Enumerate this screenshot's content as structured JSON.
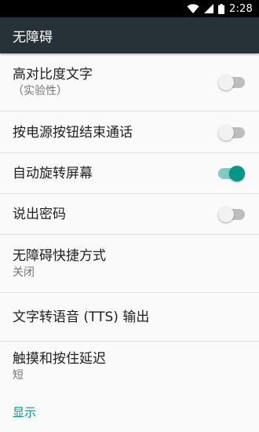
{
  "status_bar": {
    "time": "2:28",
    "icons": [
      "wifi-icon",
      "signal-icon",
      "battery-icon"
    ]
  },
  "app_bar": {
    "title": "无障碍"
  },
  "settings": {
    "items": [
      {
        "title": "高对比度文字",
        "summary": "（实验性）",
        "toggle": "off"
      },
      {
        "title": "按电源按钮结束通话",
        "toggle": "off"
      },
      {
        "title": "自动旋转屏幕",
        "toggle": "on"
      },
      {
        "title": "说出密码",
        "toggle": "off"
      },
      {
        "title": "无障碍快捷方式",
        "summary": "关闭"
      },
      {
        "title": "文字转语音 (TTS) 输出"
      },
      {
        "title": "触摸和按住延迟",
        "summary": "短"
      }
    ],
    "section_header": "显示"
  },
  "colors": {
    "app_bar": "#263238",
    "accent": "#009688",
    "background": "#fafafa"
  }
}
